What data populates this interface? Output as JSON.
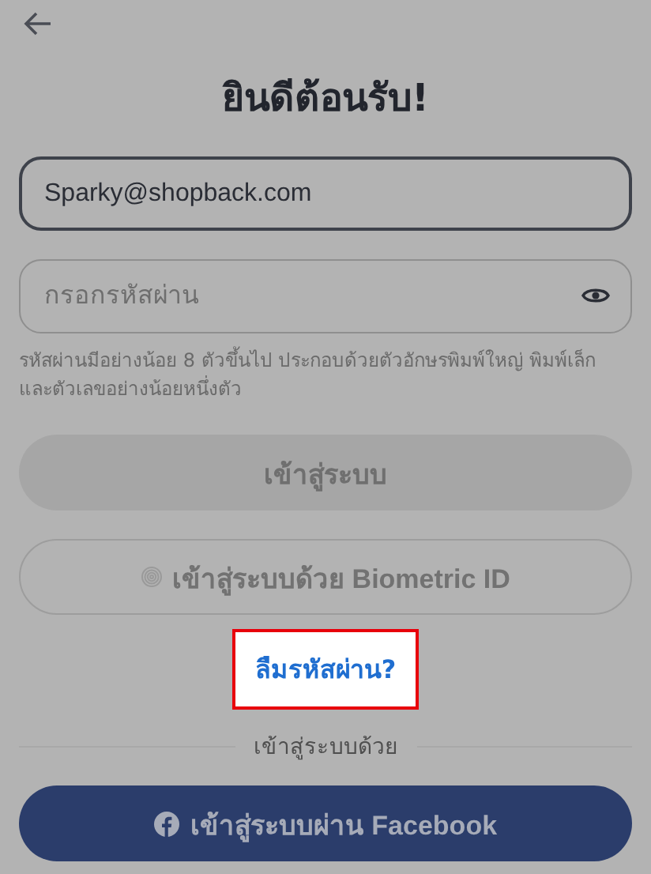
{
  "title": "ยินดีต้อนรับ!",
  "email_field": {
    "value": "Sparky@shopback.com"
  },
  "password_field": {
    "placeholder": "กรอกรหัสผ่าน"
  },
  "password_hint": "รหัสผ่านมีอย่างน้อย 8 ตัวขึ้นไป ประกอบด้วยตัวอักษรพิมพ์ใหญ่ พิมพ์เล็ก และตัวเลขอย่างน้อยหนึ่งตัว",
  "login_button": {
    "label": "เข้าสู่ระบบ",
    "disabled": true
  },
  "biometric_button": {
    "label": "เข้าสู่ระบบด้วย Biometric ID"
  },
  "forgot_link": {
    "label": "ลืมรหัสผ่าน?",
    "highlighted": true
  },
  "divider_label": "เข้าสู่ระบบด้วย",
  "facebook_button": {
    "label": "เข้าสู่ระบบผ่าน Facebook"
  }
}
